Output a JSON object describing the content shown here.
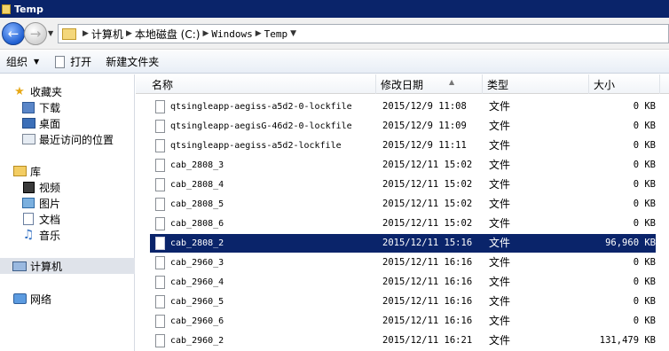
{
  "window": {
    "title": "Temp"
  },
  "address": {
    "crumbs": [
      "计算机",
      "本地磁盘 (C:)",
      "Windows",
      "Temp"
    ]
  },
  "toolbar": {
    "organize_label": "组织",
    "open_label": "打开",
    "new_folder_label": "新建文件夹"
  },
  "nav": {
    "favorites_label": "收藏夹",
    "downloads_label": "下载",
    "desktop_label": "桌面",
    "recent_label": "最近访问的位置",
    "libraries_label": "库",
    "videos_label": "视频",
    "pictures_label": "图片",
    "documents_label": "文档",
    "music_label": "音乐",
    "computer_label": "计算机",
    "network_label": "网络"
  },
  "columns": {
    "name": "名称",
    "date": "修改日期",
    "type": "类型",
    "size": "大小"
  },
  "files": [
    {
      "name": "qtsingleapp-aegiss-a5d2-0-lockfile",
      "date": "2015/12/9 11:08",
      "type": "文件",
      "size": "0 KB"
    },
    {
      "name": "qtsingleapp-aegisG-46d2-0-lockfile",
      "date": "2015/12/9 11:09",
      "type": "文件",
      "size": "0 KB"
    },
    {
      "name": "qtsingleapp-aegiss-a5d2-lockfile",
      "date": "2015/12/9 11:11",
      "type": "文件",
      "size": "0 KB"
    },
    {
      "name": "cab_2808_3",
      "date": "2015/12/11 15:02",
      "type": "文件",
      "size": "0 KB"
    },
    {
      "name": "cab_2808_4",
      "date": "2015/12/11 15:02",
      "type": "文件",
      "size": "0 KB"
    },
    {
      "name": "cab_2808_5",
      "date": "2015/12/11 15:02",
      "type": "文件",
      "size": "0 KB"
    },
    {
      "name": "cab_2808_6",
      "date": "2015/12/11 15:02",
      "type": "文件",
      "size": "0 KB"
    },
    {
      "name": "cab_2808_2",
      "date": "2015/12/11 15:16",
      "type": "文件",
      "size": "96,960 KB"
    },
    {
      "name": "cab_2960_3",
      "date": "2015/12/11 16:16",
      "type": "文件",
      "size": "0 KB"
    },
    {
      "name": "cab_2960_4",
      "date": "2015/12/11 16:16",
      "type": "文件",
      "size": "0 KB"
    },
    {
      "name": "cab_2960_5",
      "date": "2015/12/11 16:16",
      "type": "文件",
      "size": "0 KB"
    },
    {
      "name": "cab_2960_6",
      "date": "2015/12/11 16:16",
      "type": "文件",
      "size": "0 KB"
    },
    {
      "name": "cab_2960_2",
      "date": "2015/12/11 16:21",
      "type": "文件",
      "size": "131,479 KB"
    }
  ],
  "selected_file": "cab_2808_2"
}
